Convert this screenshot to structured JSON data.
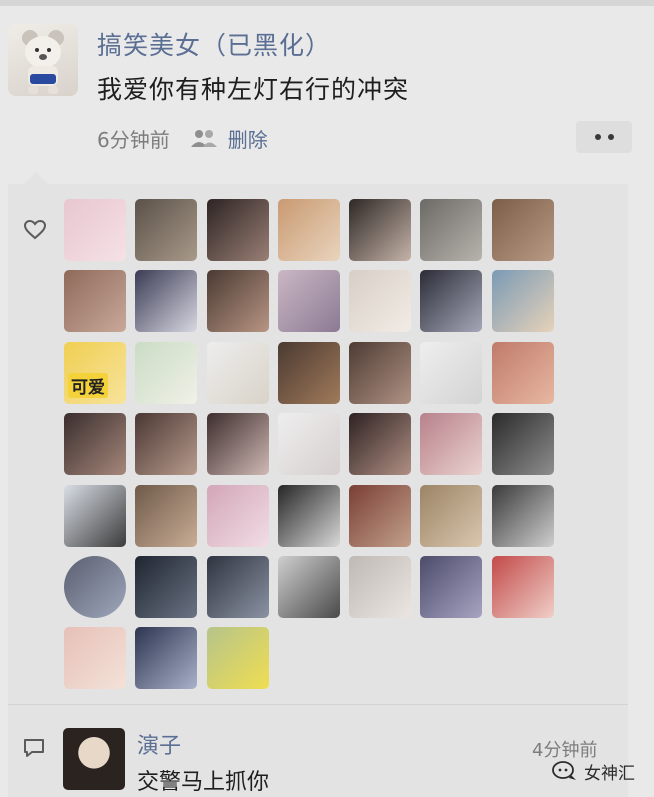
{
  "post": {
    "username": "搞笑美女（已黑化）",
    "text": "我爱你有种左灯右行的冲突",
    "time": "6分钟前",
    "delete_label": "删除",
    "avatar_icon": "teddy-bear-avatar",
    "more_icon": "more-dots-icon"
  },
  "likes": {
    "icon": "heart-icon",
    "avatars": [
      {
        "colors": [
          "#e8c7cf",
          "#f5e1e6"
        ],
        "round": false
      },
      {
        "colors": [
          "#5b5148",
          "#a89a8a"
        ],
        "round": false
      },
      {
        "colors": [
          "#2d2424",
          "#9a7f75"
        ],
        "round": false
      },
      {
        "colors": [
          "#c99a72",
          "#e9d4bd"
        ],
        "round": false
      },
      {
        "colors": [
          "#2e2826",
          "#c5b3a8"
        ],
        "round": false
      },
      {
        "colors": [
          "#6c6a66",
          "#b7b3ad"
        ],
        "round": false
      },
      {
        "colors": [
          "#7b5d49",
          "#b99b85"
        ],
        "round": false
      },
      {
        "colors": [
          "#8e6a5a",
          "#c9a89a"
        ],
        "round": false
      },
      {
        "colors": [
          "#3b3b55",
          "#d8d8e2"
        ],
        "round": false
      },
      {
        "colors": [
          "#4a3a32",
          "#b89584"
        ],
        "round": false
      },
      {
        "colors": [
          "#c9b7c4",
          "#8c7a94"
        ],
        "round": false
      },
      {
        "colors": [
          "#d7cfc6",
          "#f2ece6"
        ],
        "round": false
      },
      {
        "colors": [
          "#2c2c38",
          "#a5a7b8"
        ],
        "round": false
      },
      {
        "colors": [
          "#7a9ab5",
          "#e6d2b9"
        ],
        "round": false
      },
      {
        "colors": [
          "#f0cf52",
          "#f7e39c"
        ],
        "round": false,
        "sticker": "可爱"
      },
      {
        "colors": [
          "#c9dcc4",
          "#f1f1e8"
        ],
        "round": false
      },
      {
        "colors": [
          "#ededed",
          "#d9d3c8"
        ],
        "round": false
      },
      {
        "colors": [
          "#4b3a32",
          "#a07a5a"
        ],
        "round": false
      },
      {
        "colors": [
          "#4d3b33",
          "#b09284"
        ],
        "round": false
      },
      {
        "colors": [
          "#eeeeee",
          "#d3d3d3"
        ],
        "round": false
      },
      {
        "colors": [
          "#c07a6a",
          "#e7b8a1"
        ],
        "round": false
      },
      {
        "colors": [
          "#3a2e2e",
          "#a5877a"
        ],
        "round": false
      },
      {
        "colors": [
          "#4a3733",
          "#b89c8d"
        ],
        "round": false
      },
      {
        "colors": [
          "#3d2d2d",
          "#cfb9b4"
        ],
        "round": false
      },
      {
        "colors": [
          "#eeeeee",
          "#d6cfcf"
        ],
        "round": false
      },
      {
        "colors": [
          "#2d2222",
          "#b08f83"
        ],
        "round": false
      },
      {
        "colors": [
          "#b8818b",
          "#ead2cf"
        ],
        "round": false
      },
      {
        "colors": [
          "#2a2a2a",
          "#8e8e8e"
        ],
        "round": false
      },
      {
        "colors": [
          "#d9dee6",
          "#3b3b3b"
        ],
        "round": false
      },
      {
        "colors": [
          "#6e5a4a",
          "#c9ad95"
        ],
        "round": false
      },
      {
        "colors": [
          "#d3a6b8",
          "#f1dde5"
        ],
        "round": false
      },
      {
        "colors": [
          "#262626",
          "#d9d9d9"
        ],
        "round": false
      },
      {
        "colors": [
          "#7a3f35",
          "#c3a08c"
        ],
        "round": false
      },
      {
        "colors": [
          "#9c8466",
          "#d9c7ae"
        ],
        "round": false
      },
      {
        "colors": [
          "#3a3a3a",
          "#cfcfcf"
        ],
        "round": false
      },
      {
        "colors": [
          "#5a5f70",
          "#9fa7bb"
        ],
        "round": true
      },
      {
        "colors": [
          "#1f2530",
          "#6a7384"
        ],
        "round": false
      },
      {
        "colors": [
          "#2f3440",
          "#8b93a3"
        ],
        "round": false
      },
      {
        "colors": [
          "#cfcfcf",
          "#4a4a4a"
        ],
        "round": false
      },
      {
        "colors": [
          "#bfb9b6",
          "#ebe6e2"
        ],
        "round": false
      },
      {
        "colors": [
          "#4c4b6a",
          "#a7a4c2"
        ],
        "round": false
      },
      {
        "colors": [
          "#c24a4a",
          "#f0cfc7"
        ],
        "round": false
      },
      {
        "colors": [
          "#e6c0b8",
          "#f3e2d8"
        ],
        "round": false
      },
      {
        "colors": [
          "#2d3550",
          "#aab2cb"
        ],
        "round": false
      },
      {
        "colors": [
          "#b5c48a",
          "#f0de52"
        ],
        "round": false
      }
    ]
  },
  "comment": {
    "icon": "comment-icon",
    "name": "演子",
    "time": "4分钟前",
    "text": "交警马上抓你"
  },
  "watermark": {
    "text": "女神汇",
    "logo_icon": "wechat-channel-logo"
  }
}
